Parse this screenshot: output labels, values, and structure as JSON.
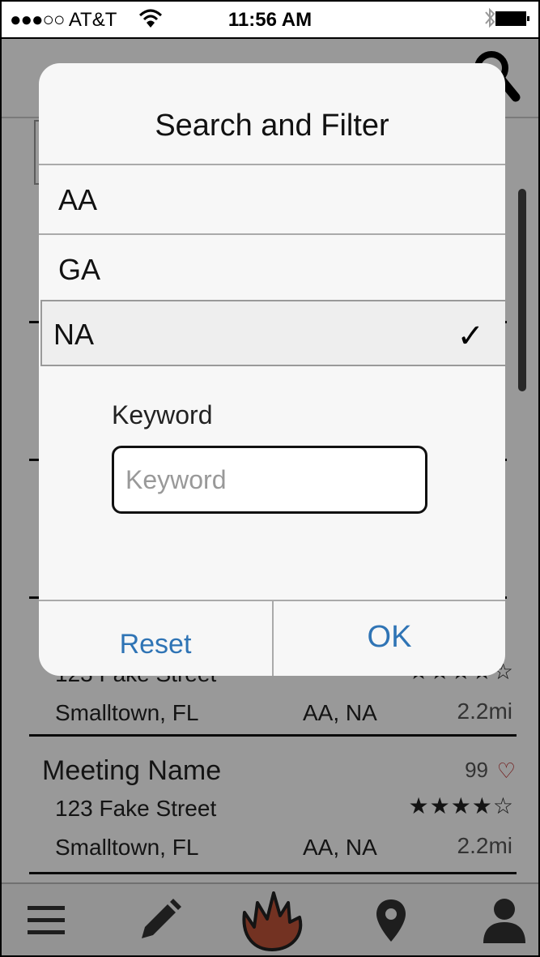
{
  "status_bar": {
    "signal": "●●●○○",
    "carrier": "AT&T",
    "time": "11:56 AM"
  },
  "meetings": [
    {
      "name": "",
      "count": "",
      "street": "123 Fake Street",
      "rating": "★★★★☆",
      "city": "Smalltown, FL",
      "groups": "AA, NA",
      "distance": "2.2mi"
    },
    {
      "name": "Meeting Name",
      "count": "99",
      "street": "123 Fake Street",
      "rating": "★★★★☆",
      "city": "Smalltown, FL",
      "groups": "AA, NA",
      "distance": "2.2mi"
    }
  ],
  "dialog": {
    "title": "Search and Filter",
    "options": [
      {
        "label": "AA",
        "selected": false
      },
      {
        "label": "GA",
        "selected": false
      },
      {
        "label": "NA",
        "selected": true
      }
    ],
    "check_mark": "✓",
    "keyword_label": "Keyword",
    "keyword_placeholder": "Keyword",
    "keyword_value": "",
    "reset_label": "Reset",
    "ok_label": "OK"
  },
  "icons": {
    "status": [
      "wifi-icon",
      "bluetooth-icon",
      "battery-icon"
    ],
    "header": [
      "search-icon"
    ],
    "tabs": [
      "menu-icon",
      "pencil-icon",
      "flame-icon",
      "location-pin-icon",
      "user-icon"
    ],
    "heart": "heart-icon"
  },
  "colors": {
    "accent": "#2f74b5",
    "heart": "#b22222",
    "flame": "#c0543a"
  }
}
